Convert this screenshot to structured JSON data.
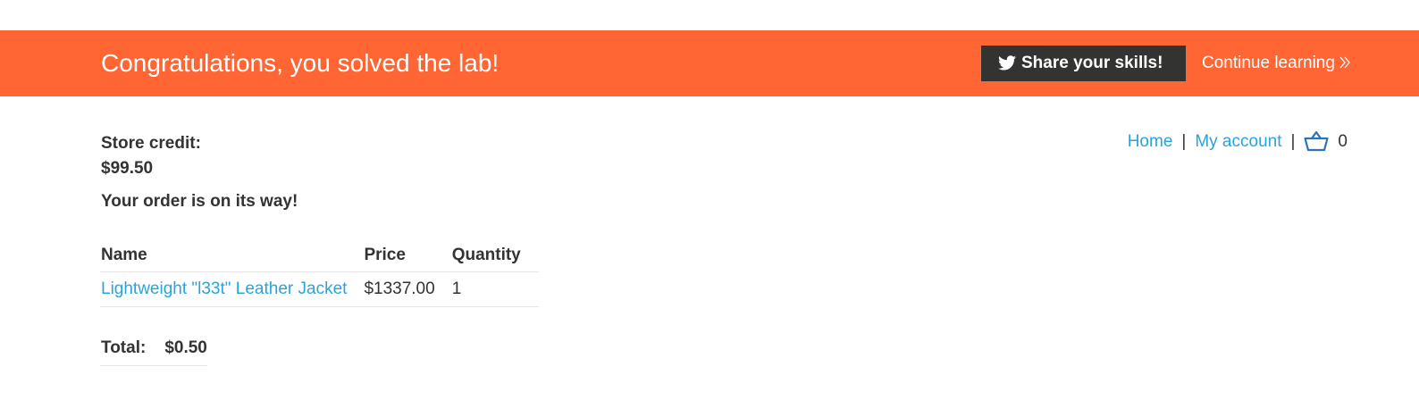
{
  "banner": {
    "title": "Congratulations, you solved the lab!",
    "share_label": "Share your skills!",
    "share_icon": "twitter-icon",
    "continue_label": "Continue learning",
    "continue_icon": "double-chevron-right-icon",
    "background_color": "#ff6633"
  },
  "nav": {
    "home": "Home",
    "account": "My account",
    "separator": "|",
    "cart_icon": "basket-icon",
    "cart_count": "0"
  },
  "credit": {
    "label": "Store credit:",
    "value": "$99.50"
  },
  "order_message": "Your order is on its way!",
  "order": {
    "headers": [
      "Name",
      "Price",
      "Quantity"
    ],
    "rows": [
      {
        "name": "Lightweight \"l33t\" Leather Jacket",
        "price": "$1337.00",
        "quantity": "1"
      }
    ]
  },
  "total": {
    "label": "Total:",
    "value": "$0.50"
  },
  "colors": {
    "link": "#29a4d9",
    "text": "#333332",
    "button": "#333332"
  }
}
